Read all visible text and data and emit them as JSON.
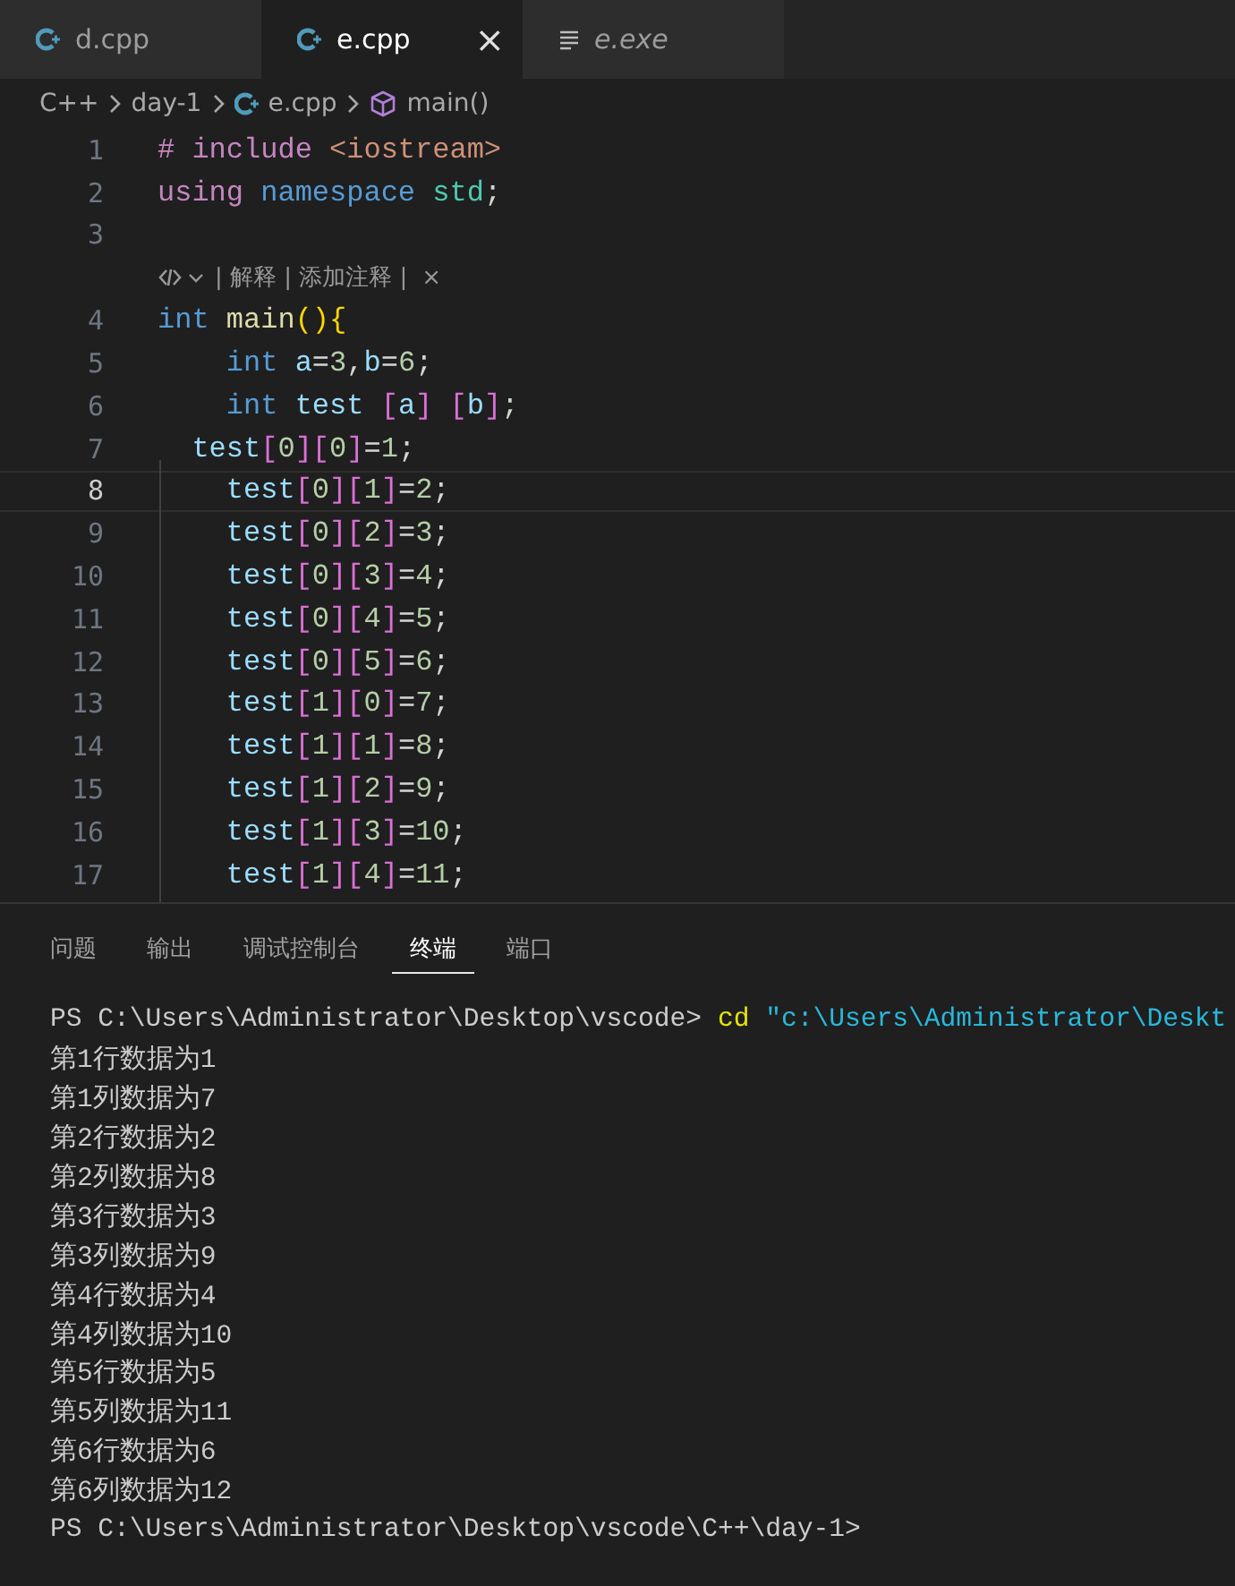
{
  "tabs": [
    {
      "label": "d.cpp",
      "kind": "cpp",
      "selected": false,
      "preview": false
    },
    {
      "label": "e.cpp",
      "kind": "cpp",
      "selected": true,
      "preview": false,
      "close": "×"
    },
    {
      "label": "e.exe",
      "kind": "text",
      "selected": false,
      "preview": true
    }
  ],
  "breadcrumb": [
    {
      "label": "C++",
      "kind": "folder"
    },
    {
      "label": "day-1",
      "kind": "folder"
    },
    {
      "label": "e.cpp",
      "kind": "cpp"
    },
    {
      "label": "main()",
      "kind": "symbol"
    }
  ],
  "code": [
    {
      "number": "1",
      "current": false,
      "tokens": [
        {
          "kind": "control",
          "t": "# include "
        },
        {
          "kind": "string",
          "t": "<iostream>"
        }
      ]
    },
    {
      "number": "2",
      "current": false,
      "tokens": [
        {
          "kind": "control",
          "t": "using "
        },
        {
          "kind": "keyword",
          "t": "namespace "
        },
        {
          "kind": "type",
          "t": "std"
        },
        {
          "kind": "plain",
          "t": ";"
        }
      ]
    },
    {
      "number": "3",
      "current": false
    },
    {
      "codelens": {
        "text": "| 解释 | 添加注释 |",
        "close": "×"
      }
    },
    {
      "number": "4",
      "current": false,
      "tokens": [
        {
          "kind": "keyword",
          "t": "int "
        },
        {
          "kind": "function",
          "t": "main"
        },
        {
          "kind": "bracket1",
          "t": "(){"
        }
      ]
    },
    {
      "number": "5",
      "current": false,
      "tokens": [
        {
          "kind": "keyword",
          "t": "    int "
        },
        {
          "kind": "variable",
          "t": "a"
        },
        {
          "kind": "plain",
          "t": "="
        },
        {
          "kind": "number",
          "t": "3"
        },
        {
          "kind": "plain",
          "t": ","
        },
        {
          "kind": "variable",
          "t": "b"
        },
        {
          "kind": "plain",
          "t": "="
        },
        {
          "kind": "number",
          "t": "6"
        },
        {
          "kind": "plain",
          "t": ";"
        }
      ]
    },
    {
      "number": "6",
      "current": false,
      "tokens": [
        {
          "kind": "keyword",
          "t": "    int "
        },
        {
          "kind": "variable",
          "t": "test "
        },
        {
          "kind": "bracket2",
          "t": "["
        },
        {
          "kind": "variable",
          "t": "a"
        },
        {
          "kind": "bracket2",
          "t": "] ["
        },
        {
          "kind": "variable",
          "t": "b"
        },
        {
          "kind": "bracket2",
          "t": "]"
        },
        {
          "kind": "plain",
          "t": ";"
        }
      ]
    },
    {
      "number": "7",
      "current": false,
      "tokens": [
        {
          "kind": "variable",
          "t": "  test"
        },
        {
          "kind": "bracket2",
          "t": "["
        },
        {
          "kind": "number",
          "t": "0"
        },
        {
          "kind": "bracket2",
          "t": "]["
        },
        {
          "kind": "number",
          "t": "0"
        },
        {
          "kind": "bracket2",
          "t": "]"
        },
        {
          "kind": "plain",
          "t": "="
        },
        {
          "kind": "number",
          "t": "1"
        },
        {
          "kind": "plain",
          "t": ";"
        }
      ]
    },
    {
      "number": "8",
      "current": true,
      "tokens": [
        {
          "kind": "variable",
          "t": "    test"
        },
        {
          "kind": "bracket2",
          "t": "["
        },
        {
          "kind": "number",
          "t": "0"
        },
        {
          "kind": "bracket2",
          "t": "]["
        },
        {
          "kind": "number",
          "t": "1"
        },
        {
          "kind": "bracket2",
          "t": "]"
        },
        {
          "kind": "plain",
          "t": "="
        },
        {
          "kind": "number",
          "t": "2"
        },
        {
          "kind": "plain",
          "t": ";"
        }
      ]
    },
    {
      "number": "9",
      "current": false,
      "tokens": [
        {
          "kind": "variable",
          "t": "    test"
        },
        {
          "kind": "bracket2",
          "t": "["
        },
        {
          "kind": "number",
          "t": "0"
        },
        {
          "kind": "bracket2",
          "t": "]["
        },
        {
          "kind": "number",
          "t": "2"
        },
        {
          "kind": "bracket2",
          "t": "]"
        },
        {
          "kind": "plain",
          "t": "="
        },
        {
          "kind": "number",
          "t": "3"
        },
        {
          "kind": "plain",
          "t": ";"
        }
      ]
    },
    {
      "number": "10",
      "current": false,
      "tokens": [
        {
          "kind": "variable",
          "t": "    test"
        },
        {
          "kind": "bracket2",
          "t": "["
        },
        {
          "kind": "number",
          "t": "0"
        },
        {
          "kind": "bracket2",
          "t": "]["
        },
        {
          "kind": "number",
          "t": "3"
        },
        {
          "kind": "bracket2",
          "t": "]"
        },
        {
          "kind": "plain",
          "t": "="
        },
        {
          "kind": "number",
          "t": "4"
        },
        {
          "kind": "plain",
          "t": ";"
        }
      ]
    },
    {
      "number": "11",
      "current": false,
      "tokens": [
        {
          "kind": "variable",
          "t": "    test"
        },
        {
          "kind": "bracket2",
          "t": "["
        },
        {
          "kind": "number",
          "t": "0"
        },
        {
          "kind": "bracket2",
          "t": "]["
        },
        {
          "kind": "number",
          "t": "4"
        },
        {
          "kind": "bracket2",
          "t": "]"
        },
        {
          "kind": "plain",
          "t": "="
        },
        {
          "kind": "number",
          "t": "5"
        },
        {
          "kind": "plain",
          "t": ";"
        }
      ]
    },
    {
      "number": "12",
      "current": false,
      "tokens": [
        {
          "kind": "variable",
          "t": "    test"
        },
        {
          "kind": "bracket2",
          "t": "["
        },
        {
          "kind": "number",
          "t": "0"
        },
        {
          "kind": "bracket2",
          "t": "]["
        },
        {
          "kind": "number",
          "t": "5"
        },
        {
          "kind": "bracket2",
          "t": "]"
        },
        {
          "kind": "plain",
          "t": "="
        },
        {
          "kind": "number",
          "t": "6"
        },
        {
          "kind": "plain",
          "t": ";"
        }
      ]
    },
    {
      "number": "13",
      "current": false,
      "tokens": [
        {
          "kind": "variable",
          "t": "    test"
        },
        {
          "kind": "bracket2",
          "t": "["
        },
        {
          "kind": "number",
          "t": "1"
        },
        {
          "kind": "bracket2",
          "t": "]["
        },
        {
          "kind": "number",
          "t": "0"
        },
        {
          "kind": "bracket2",
          "t": "]"
        },
        {
          "kind": "plain",
          "t": "="
        },
        {
          "kind": "number",
          "t": "7"
        },
        {
          "kind": "plain",
          "t": ";"
        }
      ]
    },
    {
      "number": "14",
      "current": false,
      "tokens": [
        {
          "kind": "variable",
          "t": "    test"
        },
        {
          "kind": "bracket2",
          "t": "["
        },
        {
          "kind": "number",
          "t": "1"
        },
        {
          "kind": "bracket2",
          "t": "]["
        },
        {
          "kind": "number",
          "t": "1"
        },
        {
          "kind": "bracket2",
          "t": "]"
        },
        {
          "kind": "plain",
          "t": "="
        },
        {
          "kind": "number",
          "t": "8"
        },
        {
          "kind": "plain",
          "t": ";"
        }
      ]
    },
    {
      "number": "15",
      "current": false,
      "tokens": [
        {
          "kind": "variable",
          "t": "    test"
        },
        {
          "kind": "bracket2",
          "t": "["
        },
        {
          "kind": "number",
          "t": "1"
        },
        {
          "kind": "bracket2",
          "t": "]["
        },
        {
          "kind": "number",
          "t": "2"
        },
        {
          "kind": "bracket2",
          "t": "]"
        },
        {
          "kind": "plain",
          "t": "="
        },
        {
          "kind": "number",
          "t": "9"
        },
        {
          "kind": "plain",
          "t": ";"
        }
      ]
    },
    {
      "number": "16",
      "current": false,
      "tokens": [
        {
          "kind": "variable",
          "t": "    test"
        },
        {
          "kind": "bracket2",
          "t": "["
        },
        {
          "kind": "number",
          "t": "1"
        },
        {
          "kind": "bracket2",
          "t": "]["
        },
        {
          "kind": "number",
          "t": "3"
        },
        {
          "kind": "bracket2",
          "t": "]"
        },
        {
          "kind": "plain",
          "t": "="
        },
        {
          "kind": "number",
          "t": "10"
        },
        {
          "kind": "plain",
          "t": ";"
        }
      ]
    },
    {
      "number": "17",
      "current": false,
      "tokens": [
        {
          "kind": "variable",
          "t": "    test"
        },
        {
          "kind": "bracket2",
          "t": "["
        },
        {
          "kind": "number",
          "t": "1"
        },
        {
          "kind": "bracket2",
          "t": "]["
        },
        {
          "kind": "number",
          "t": "4"
        },
        {
          "kind": "bracket2",
          "t": "]"
        },
        {
          "kind": "plain",
          "t": "="
        },
        {
          "kind": "number",
          "t": "11"
        },
        {
          "kind": "plain",
          "t": ";"
        }
      ]
    }
  ],
  "panel_tabs": [
    {
      "label": "问题",
      "selected": false
    },
    {
      "label": "输出",
      "selected": false
    },
    {
      "label": "调试控制台",
      "selected": false
    },
    {
      "label": "终端",
      "selected": true
    },
    {
      "label": "端口",
      "selected": false
    }
  ],
  "terminal": [
    [
      {
        "kind": "output",
        "t": "PS C:\\Users\\Administrator\\Desktop\\vscode> "
      },
      {
        "kind": "command",
        "t": "cd "
      },
      {
        "kind": "argument",
        "t": "\"c:\\Users\\Administrator\\Deskt"
      }
    ],
    [
      {
        "kind": "output",
        "t": "第1行数据为1"
      }
    ],
    [
      {
        "kind": "output",
        "t": "第1列数据为7"
      }
    ],
    [
      {
        "kind": "output",
        "t": "第2行数据为2"
      }
    ],
    [
      {
        "kind": "output",
        "t": "第2列数据为8"
      }
    ],
    [
      {
        "kind": "output",
        "t": "第3行数据为3"
      }
    ],
    [
      {
        "kind": "output",
        "t": "第3列数据为9"
      }
    ],
    [
      {
        "kind": "output",
        "t": "第4行数据为4"
      }
    ],
    [
      {
        "kind": "output",
        "t": "第4列数据为10"
      }
    ],
    [
      {
        "kind": "output",
        "t": "第5行数据为5"
      }
    ],
    [
      {
        "kind": "output",
        "t": "第5列数据为11"
      }
    ],
    [
      {
        "kind": "output",
        "t": "第6行数据为6"
      }
    ],
    [
      {
        "kind": "output",
        "t": "第6列数据为12"
      }
    ],
    [
      {
        "kind": "output",
        "t": "PS C:\\Users\\Administrator\\Desktop\\vscode\\C++\\day-1> "
      }
    ]
  ]
}
